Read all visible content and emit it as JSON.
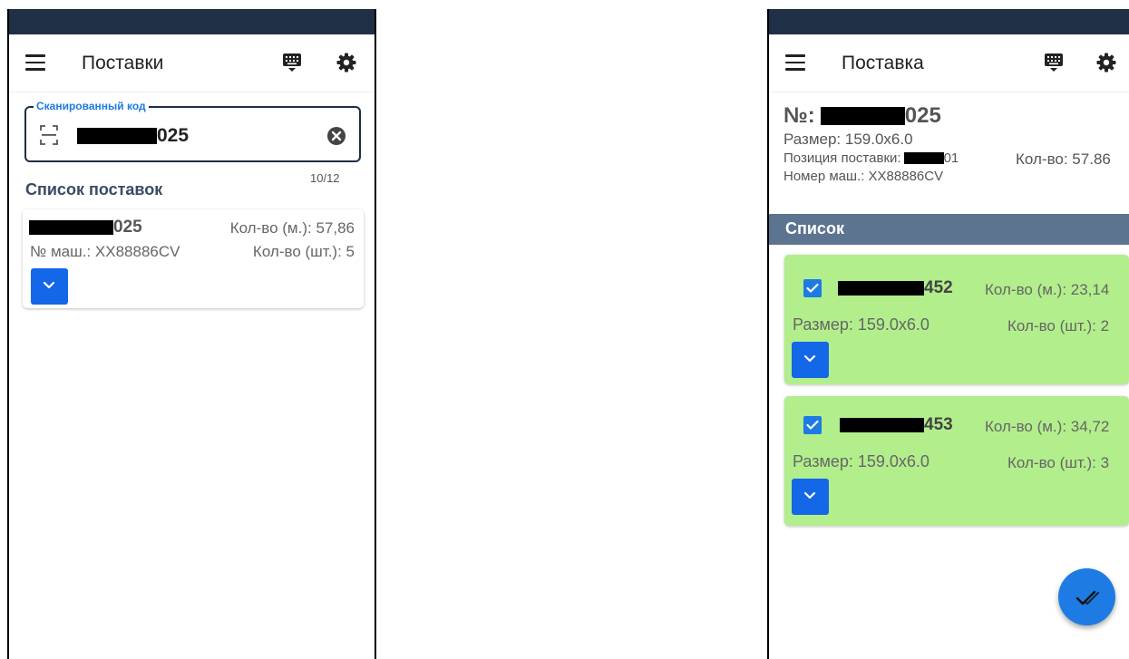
{
  "left_screen": {
    "appbar": {
      "title": "Поставки",
      "menu_icon": "menu-icon",
      "keyboard_icon": "keyboard-icon",
      "settings_icon": "gear-icon"
    },
    "scan_field": {
      "label": "Сканированный код",
      "value_suffix": "025",
      "counter": "10/12",
      "icon": "scan-icon",
      "clear_icon": "clear-icon"
    },
    "section_title": "Список поставок",
    "delivery": {
      "code_suffix": "025",
      "qty_m": "Кол-во (м.): 57,86",
      "machine": "№ маш.: XX88886CV",
      "qty_pcs": "Кол-во (шт.): 5"
    }
  },
  "right_screen": {
    "appbar": {
      "title": "Поставка",
      "menu_icon": "menu-icon",
      "keyboard_icon": "keyboard-icon",
      "settings_icon": "gear-icon"
    },
    "header": {
      "number_prefix": "№:",
      "number_suffix": "025",
      "size": "Размер: 159.0x6.0",
      "position_label": "Позиция поставки:",
      "position_suffix": "01",
      "qty": "Кол-во: 57.86",
      "machine": "Номер маш.: XX88886CV"
    },
    "list_title": "Список",
    "items": [
      {
        "code_suffix": "452",
        "qty_m": "Кол-во (м.): 23,14",
        "size": "Размер: 159.0x6.0",
        "qty_pcs": "Кол-во (шт.): 2",
        "checked": true
      },
      {
        "code_suffix": "453",
        "qty_m": "Кол-во (м.): 34,72",
        "size": "Размер: 159.0x6.0",
        "qty_pcs": "Кол-во (шт.): 3",
        "checked": true
      }
    ],
    "fab_icon": "check-all-icon"
  },
  "colors": {
    "statusbar": "#1f2f45",
    "accent": "#1e7be3",
    "button": "#1467e6",
    "list_header": "#5d7490",
    "item_checked_bg": "#b2ee8c"
  }
}
